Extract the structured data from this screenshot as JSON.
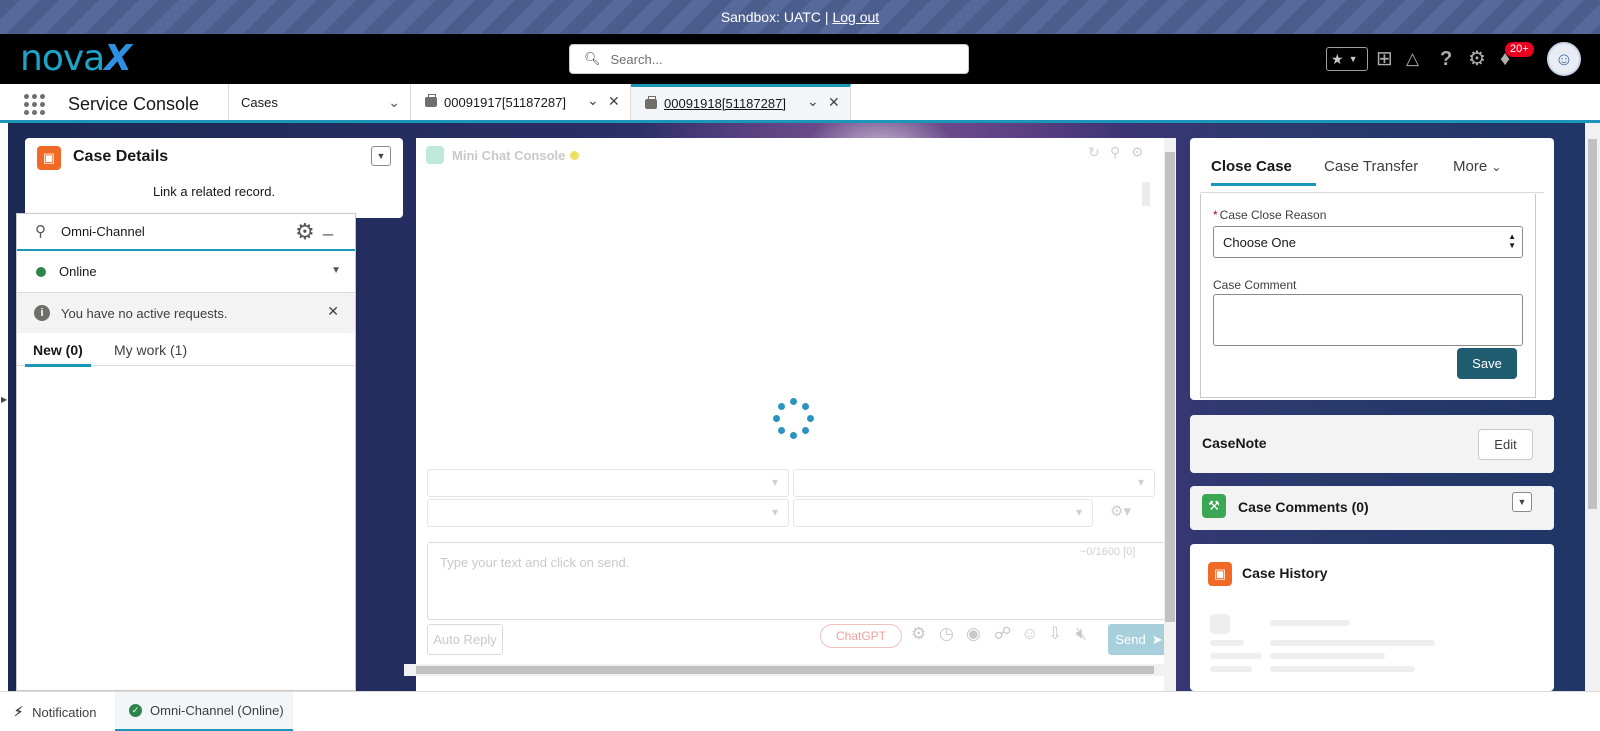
{
  "banner": {
    "text": "Sandbox: UATC |",
    "logout": "Log out"
  },
  "header": {
    "logo": {
      "part1": "nova",
      "part2": "X"
    },
    "search_placeholder": "Search...",
    "notification_badge": "20+"
  },
  "nav": {
    "app_name": "Service Console",
    "object_select": "Cases",
    "tabs": [
      {
        "label": "00091917[51187287]",
        "active": false
      },
      {
        "label": "00091918[51187287]",
        "active": true
      }
    ]
  },
  "case_details": {
    "title": "Case Details",
    "link_text": "Link a related record."
  },
  "omni_channel": {
    "title": "Omni-Channel",
    "status": "Online",
    "notice": "You have no active requests.",
    "tabs": [
      "New (0)",
      "My work (1)"
    ]
  },
  "mini_chat": {
    "title": "Mini Chat Console",
    "message_placeholder": "Type your text and click on send.",
    "counter": "~0/1600 [0]",
    "auto_reply": "Auto Reply",
    "chatgpt": "ChatGPT",
    "send": "Send"
  },
  "close_case": {
    "tabs": [
      "Close Case",
      "Case Transfer",
      "More"
    ],
    "reason_label": "Case Close Reason",
    "reason_value": "Choose One",
    "comment_label": "Case Comment",
    "save": "Save"
  },
  "case_note": {
    "title": "CaseNote",
    "edit": "Edit"
  },
  "case_comments": {
    "title": "Case Comments (0)"
  },
  "case_history": {
    "title": "Case History"
  },
  "footer": {
    "notification": "Notification",
    "omni": "Omni-Channel (Online)"
  },
  "colors": {
    "accent": "#1b96b8",
    "save_button": "#1f5c6f",
    "banner": "#4a5d8c",
    "online": "#2e844a",
    "case_icon": "#f06a25"
  }
}
